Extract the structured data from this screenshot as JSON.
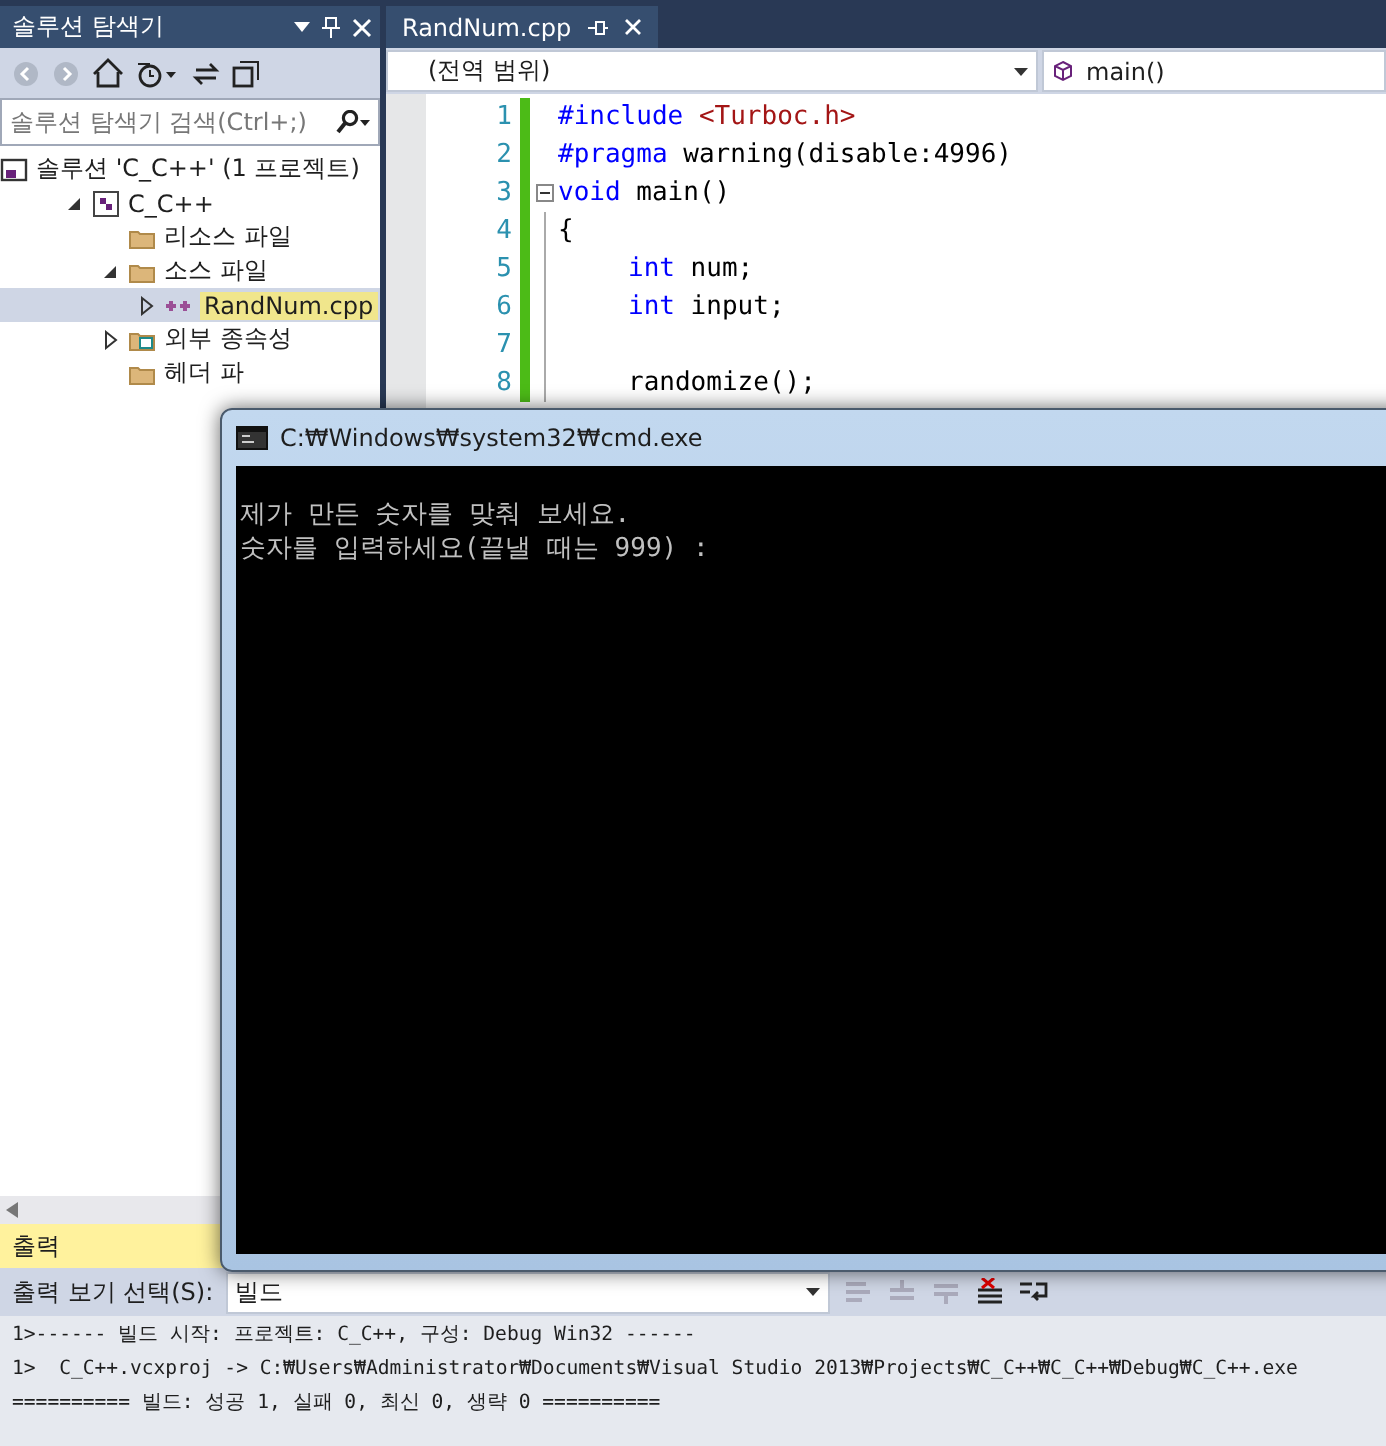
{
  "solution_explorer": {
    "title": "솔루션 탐색기",
    "search": {
      "placeholder": "솔루션 탐색기 검색(Ctrl+;)"
    },
    "tree": [
      {
        "label": "솔루션 'C_C++' (1 프로젝트)",
        "kind": "solution",
        "selected": false,
        "children": [
          {
            "label": "C_C++",
            "kind": "project",
            "expanded": true,
            "selected": false,
            "children": [
              {
                "label": "리소스 파일",
                "kind": "folder",
                "selected": false
              },
              {
                "label": "소스 파일",
                "kind": "folder",
                "expanded": true,
                "selected": false,
                "children": [
                  {
                    "label": "RandNum.cpp",
                    "kind": "file",
                    "expanded": false,
                    "selected": true
                  }
                ]
              },
              {
                "label": "외부 종속성",
                "kind": "dependencies",
                "expanded": false,
                "selected": false
              },
              {
                "label": "헤더 파",
                "kind": "folder",
                "selected": false
              }
            ]
          }
        ]
      }
    ]
  },
  "editor": {
    "tab": {
      "label": "RandNum.cpp"
    },
    "scope": "(전역 범위)",
    "member": "main()",
    "lines": [
      {
        "number": "1",
        "tokens": [
          {
            "kind": "keyword",
            "text": "#include"
          },
          {
            "kind": "string",
            "text": " <Turboc.h>"
          }
        ]
      },
      {
        "number": "2",
        "tokens": [
          {
            "kind": "keyword",
            "text": "#pragma"
          },
          {
            "kind": "text",
            "text": " warning(disable:4996)"
          }
        ]
      },
      {
        "number": "3",
        "foldable": true,
        "tokens": [
          {
            "kind": "keyword",
            "text": "void"
          },
          {
            "kind": "text",
            "text": " main()"
          }
        ]
      },
      {
        "number": "4",
        "tokens": [
          {
            "kind": "text",
            "text": "{"
          }
        ],
        "children": [
          {
            "number": "5",
            "tokens": [
              {
                "kind": "keyword",
                "text": "int"
              },
              {
                "kind": "text",
                "text": " num;"
              }
            ]
          },
          {
            "number": "6",
            "tokens": [
              {
                "kind": "keyword",
                "text": "int"
              },
              {
                "kind": "text",
                "text": " input;"
              }
            ]
          },
          {
            "number": "7"
          },
          {
            "number": "8",
            "tokens": [
              {
                "kind": "text",
                "text": "randomize();"
              }
            ]
          }
        ]
      }
    ]
  },
  "console": {
    "title": "C:₩Windows₩system32₩cmd.exe",
    "lines": [
      "제가 만든 숫자를 맞춰 보세요.",
      "숫자를 입력하세요(끝낼 때는 999) :"
    ]
  },
  "output": {
    "title": "출력",
    "source_label": "출력 보기 선택(S):",
    "source": "빌드",
    "lines": [
      "1>------ 빌드 시작: 프로젝트: C_C++, 구성: Debug Win32 ------",
      "1>  C_C++.vcxproj -> C:₩Users₩Administrator₩Documents₩Visual Studio 2013₩Projects₩C_C++₩C_C++₩Debug₩C_C++.exe",
      "========== 빌드: 성공 1, 실패 0, 최신 0, 생략 0 =========="
    ]
  }
}
